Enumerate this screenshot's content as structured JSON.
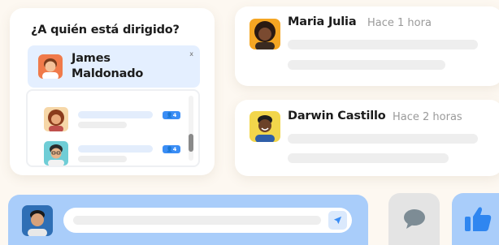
{
  "who_card": {
    "title": "¿A quién está dirigido?",
    "selected_name": "James Maldonado",
    "remove_label": "x",
    "list": [
      {
        "badge": "👤4",
        "avatar_icon": "woman-curly-hair-avatar-icon"
      },
      {
        "badge": "👤4",
        "avatar_icon": "man-glasses-avatar-icon"
      }
    ]
  },
  "notifications": [
    {
      "name": "Maria Julia",
      "time": "Hace 1 hora",
      "avatar_icon": "woman-afro-avatar-icon"
    },
    {
      "name": "Darwin Castillo",
      "time": "Hace 2 horas",
      "avatar_icon": "man-smiling-avatar-icon"
    }
  ],
  "comment_bar": {
    "send_icon": "paper-plane-icon"
  },
  "actions": {
    "chat_icon": "speech-bubble-icon",
    "like_icon": "thumbs-up-icon"
  },
  "colors": {
    "accent_blue": "#3a8df5",
    "bar_blue": "#a9cdfa",
    "chip_blue": "#e4efff",
    "background": "#fdf8f1",
    "skeleton": "#eeeeee"
  }
}
